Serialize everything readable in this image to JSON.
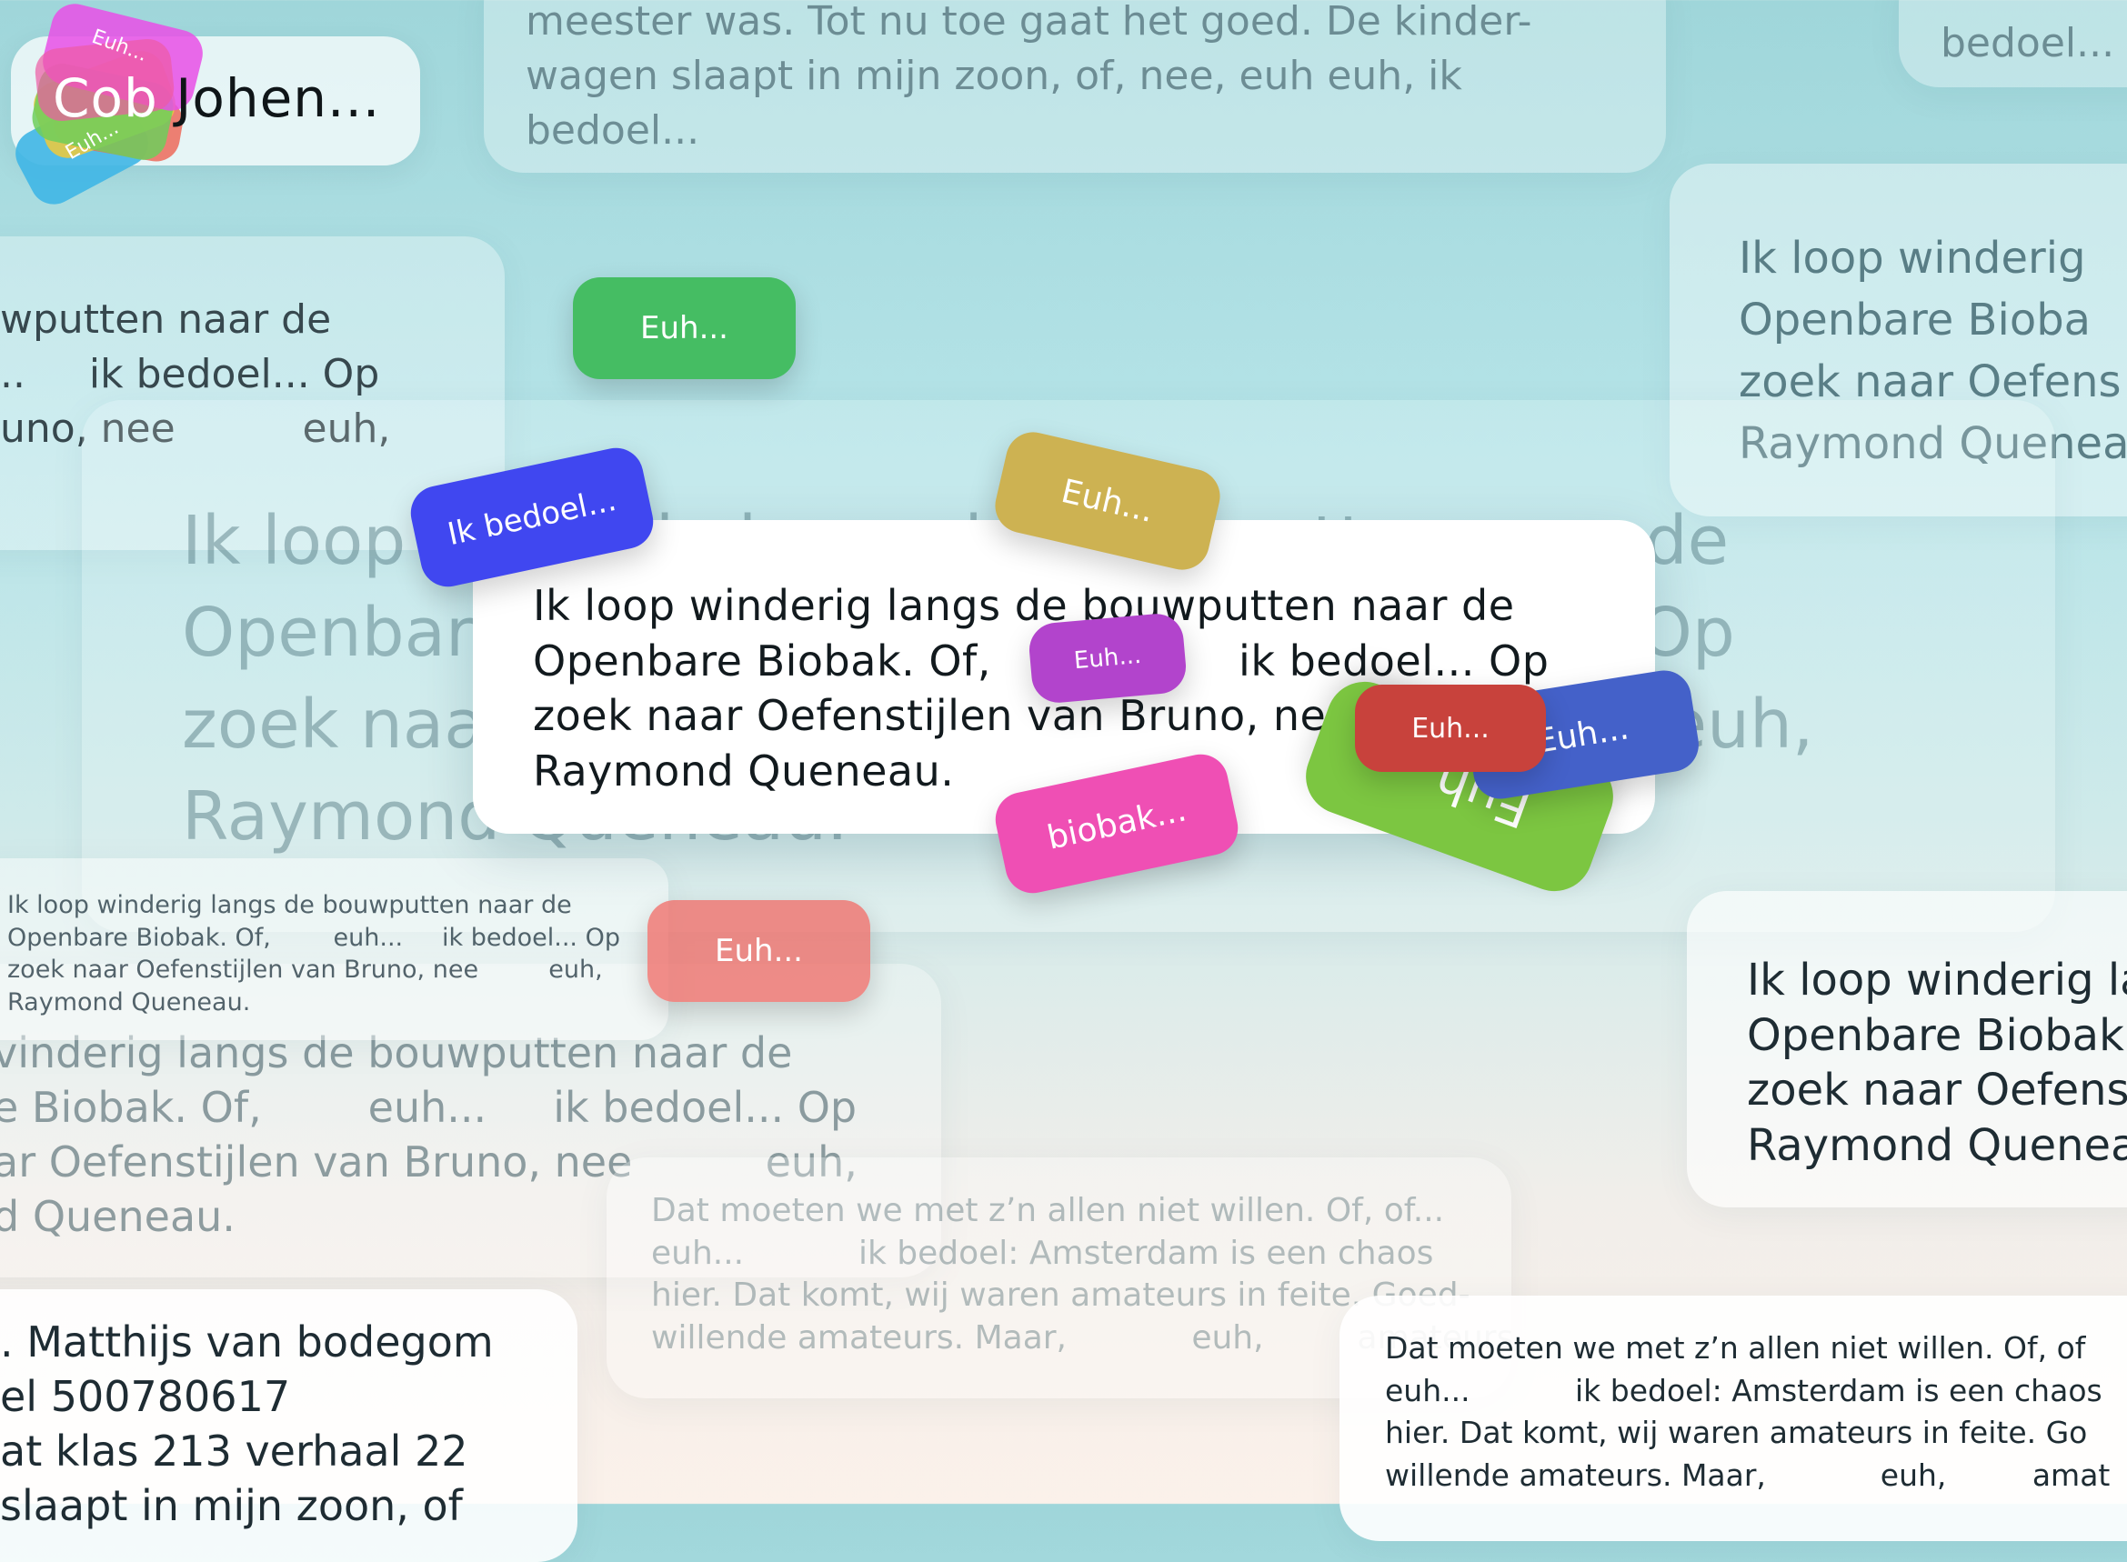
{
  "user": {
    "first_name": "Cob",
    "last_name": "Johen..."
  },
  "cards": {
    "top_center": "meester was. Tot nu toe gaat het goed. De kinder-\nwagen slaapt in mijn zoon, of, nee, euh euh, ik\nbedoel...",
    "top_right": "bedoel...",
    "left_mid": "wputten naar de\n..     ik bedoel... Op\nuno, nee          euh,",
    "big_bg": "Ik loop winderig langs de bouwputten naar de\nOpenbare Biobak. Of,                ik bedoel... Op\nzoek naar Oefenstijlen van Bruno, nee         euh,\nRaymond Queneau.",
    "right_top": "Ik loop winderig\nOpenbare Bioba\nzoek naar Oefens\nRaymond Quenea",
    "small_left": "Ik loop winderig langs de bouwputten naar de\nOpenbare Biobak. Of,        euh...     ik bedoel... Op\nzoek naar Oefenstijlen van Bruno, nee         euh,\nRaymond Queneau.",
    "mid_left": "vinderig langs de bouwputten naar de\ne Biobak. Of,        euh...     ik bedoel... Op\nar Oefenstijlen van Bruno, nee          euh,\nd Queneau.",
    "center_bottom": "Dat moeten we met z’n allen niet willen. Of, of...\neuh...           ik bedoel: Amsterdam is een chaos\nhier. Dat komt, wij waren amateurs in feite. Goed-\nwillende amateurs. Maar,            euh,         amateurs.",
    "right_mid": "Ik loop winderig la\nOpenbare Biobak.\nzoek naar Oefenst\nRaymond Queneau",
    "bottom_left": ". Matthijs van bodegom\nel 500780617\nat klas 213 verhaal 22\nslaapt in mijn zoon, of",
    "bottom_right": "Dat moeten we met z’n allen niet willen. Of, of\neuh...           ik bedoel: Amsterdam is een chaos\nhier. Dat komt, wij waren amateurs in feite. Go\nwillende amateurs. Maar,            euh,         amat"
  },
  "main_card": {
    "text": "Ik loop winderig langs de bouwputten naar de\nOpenbare Biobak. Of,                  ik bedoel... Op\nzoek naar Oefenstijlen van Bruno, nee\nRaymond Queneau."
  },
  "tags": {
    "euh_green": "Euh...",
    "ik_bedoel": "Ik bedoel...",
    "euh_gold": "Euh...",
    "euh_purple": "Euh...",
    "euh_red": "Euh...",
    "euh_blue": "Euh...",
    "euh_big_green": "Euh...",
    "biobak": "biobak...",
    "euh_salmon": "Euh...",
    "avatar_euh_1": "Euh...",
    "avatar_euh_2": "Euh..."
  },
  "colors": {
    "green": "#45bd63",
    "blue": "#4047f0",
    "gold": "#cdb252",
    "purple": "#b244cc",
    "red": "#c8423c",
    "royal_blue": "#4461c9",
    "lime": "#7cc641",
    "pink": "#ef4fb4",
    "salmon": "#ef7a75"
  }
}
